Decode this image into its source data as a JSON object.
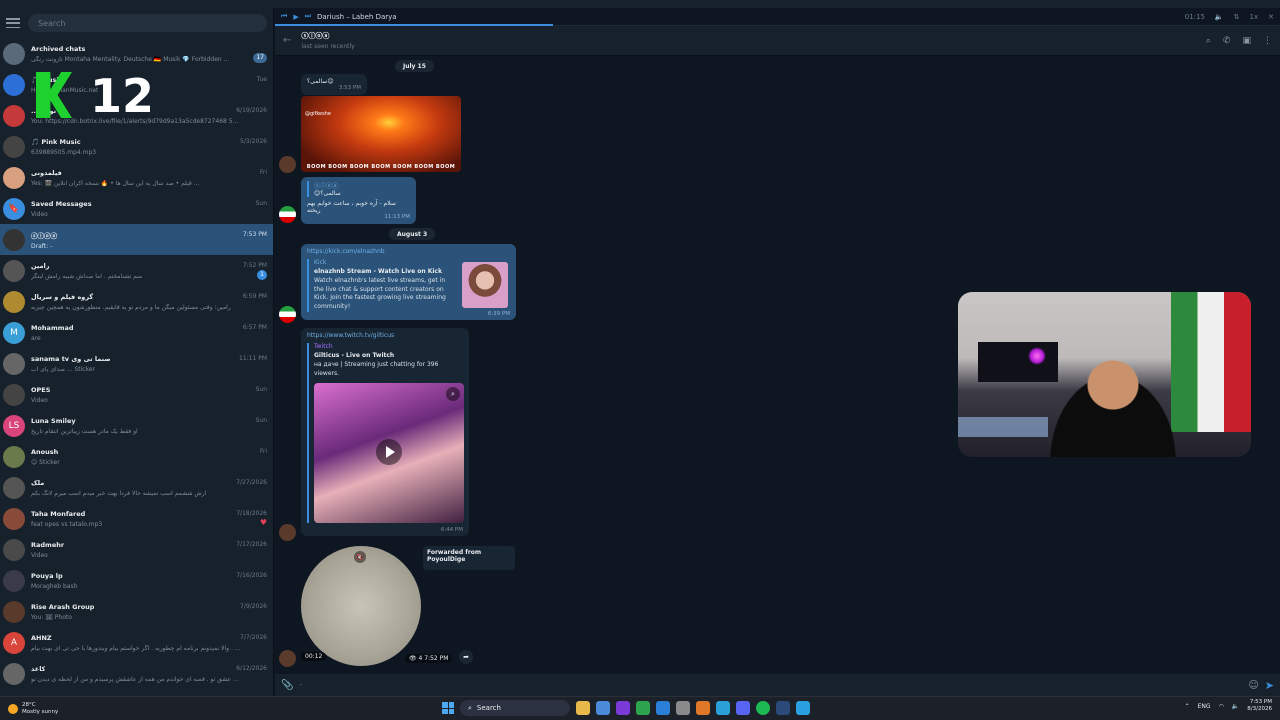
{
  "sidebar": {
    "search_placeholder": "Search",
    "chats": [
      {
        "name": "Archived chats",
        "time": "",
        "msg": "تارونت رنگی Montaha Mentality. Deutsche 🇩🇪 Musik 💎 Forbidden ...",
        "badge": "17",
        "avatar_color": "#5a6a7a",
        "avatar_text": ""
      },
      {
        "name": "🎵 Music",
        "time": "Tue",
        "msg": "Heyran ahanMusic.net",
        "badge": "",
        "avatar_color": "#2c6fd6",
        "avatar_text": ""
      },
      {
        "name": "... نوسا",
        "time": "6/19/2026",
        "msg": "You: https://cdn.botrix.live/file/1/alerts/9d79d9a13a5cde8727468 5aa4...",
        "badge": "",
        "avatar_color": "#c43a3a",
        "avatar_text": ""
      },
      {
        "name": "🎵 Pink Music",
        "time": "5/3/2026",
        "msg": "639889505.mp4.mp3",
        "badge": "",
        "avatar_color": "#444",
        "avatar_text": ""
      },
      {
        "name": "فیلمدونی",
        "time": "Fri",
        "msg": "Yes: 🎬 قیلم • صد سال یه این سال ها • 🔥 نسخه اکران آنلاین ...",
        "badge": "",
        "avatar_color": "#d9a080",
        "avatar_text": ""
      },
      {
        "name": "Saved Messages",
        "time": "Sun",
        "msg": "Video",
        "badge": "",
        "avatar_color": "#3a8ee0",
        "avatar_text": "🔖"
      },
      {
        "name": "ⓢⓘⓞⓐ",
        "time": "7:53 PM",
        "msg": "Draft: -",
        "badge": "",
        "avatar_color": "#333",
        "avatar_text": ""
      },
      {
        "name": "رامین",
        "time": "7:52 PM",
        "msg": "منم تشنامختم . اما صداش شبیه رامش لبتگر",
        "badge": "1",
        "avatar_color": "#555",
        "avatar_text": ""
      },
      {
        "name": "گروه فیلم و سریال",
        "time": "6:59 PM",
        "msg": "رامین: وقتی مسئولین میگن ما و مردم تو یه قایقیم. منظورشون یه همچین چیزیه",
        "badge": "",
        "avatar_color": "#b08a30",
        "avatar_text": ""
      },
      {
        "name": "Mohammad",
        "time": "6:57 PM",
        "msg": "are",
        "badge": "",
        "avatar_color": "#3a9fd6",
        "avatar_text": "M"
      },
      {
        "name": "sanama tv صنما تی وی",
        "time": "11:11 PM",
        "msg": "صدای پای آب ... Sticker",
        "badge": "",
        "avatar_color": "#666",
        "avatar_text": ""
      },
      {
        "name": "OPES",
        "time": "Sun",
        "msg": "Video",
        "badge": "",
        "avatar_color": "#444",
        "avatar_text": ""
      },
      {
        "name": "Luna Smiley",
        "time": "Sun",
        "msg": "او فقط یک مادر هست زیباترین انتقام تاریخ",
        "badge": "",
        "avatar_color": "#d9457a",
        "avatar_text": "LS"
      },
      {
        "name": "Anoush",
        "time": "Fri",
        "msg": "😊 Sticker",
        "badge": "",
        "avatar_color": "#6a7a4a",
        "avatar_text": ""
      },
      {
        "name": "ملک",
        "time": "7/27/2026",
        "msg": "آرش ششمم اسب تمیشه حالا فردا بهت خبر میدم اسب میرم لانگ بکم",
        "badge": "",
        "avatar_color": "#555",
        "avatar_text": ""
      },
      {
        "name": "Taha Monfared",
        "time": "7/18/2026",
        "msg": "feat opes vs tatalo.mp3",
        "badge": "♥",
        "avatar_color": "#8a4a3a",
        "avatar_text": ""
      },
      {
        "name": "Radmehr",
        "time": "7/17/2026",
        "msg": "Video",
        "badge": "",
        "avatar_color": "#4a4a4a",
        "avatar_text": ""
      },
      {
        "name": "Pouya lp",
        "time": "7/16/2026",
        "msg": "Moragheb bash",
        "badge": "",
        "avatar_color": "#3a3a4a",
        "avatar_text": ""
      },
      {
        "name": "Rise Arash Group",
        "time": "7/9/2026",
        "msg": "You: 🖼 Photo",
        "badge": "",
        "avatar_color": "#5a3a2a",
        "avatar_text": ""
      },
      {
        "name": "AHNZ",
        "time": "7/7/2026",
        "msg": "سلام آرش جون . والا نمیدونم برنامه ام چطوریه . اگر خواستم بیام ویندوزها با جی تی ای بهت بیام",
        "badge": "",
        "avatar_color": "#d9453a",
        "avatar_text": "A"
      },
      {
        "name": "کاغد",
        "time": "6/12/2026",
        "msg": "هر جا که از عشق تو . قصه ای خواندم من همه از عاشقش پرسیدم و من از لحظه ی دیدن تو",
        "badge": "",
        "avatar_color": "#666",
        "avatar_text": ""
      }
    ]
  },
  "overlay": {
    "logo_number": "12"
  },
  "player": {
    "track": "Dariush – Labeh Darya",
    "time": "01:15"
  },
  "header": {
    "title": "ⓢⓘⓞⓐ",
    "subtitle": "last seen recently"
  },
  "messages": {
    "date1": "July 15",
    "msg1_text": "سالمی؟😊",
    "msg1_time": "3:53 PM",
    "gif_watermark": "@gifkeshe",
    "gif_caption": "BOOM BOOM BOOM BOOM BOOM BOOM BOOM",
    "reply_name": "ⓢⓘⓞⓐ",
    "reply_quote": "😊سالمی؟",
    "msg2_text": "سلام - آره خوبم ، ساعت خوابم بهم ریخته",
    "msg2_time": "11:13 PM",
    "date2": "August 3",
    "kick_url": "https://kick.com/elnazhnb",
    "kick_site": "Kick",
    "kick_title": "elnazhnb Stream - Watch Live on Kick",
    "kick_desc": "Watch elnazhnb's latest live streams, get in the live chat & support content creators on Kick. Join the fastest growing live streaming community!",
    "kick_time": "6:39 PM",
    "twitch_url": "https://www.twitch.tv/gilticus",
    "twitch_site": "Twitch",
    "twitch_title": "Gilticus - Live on Twitch",
    "twitch_desc": "на даче | Streaming just chatting for 396 viewers.",
    "twitch_time": "6:44 PM",
    "fwd_label": "Forwarded from",
    "fwd_name": "PoyoulDige",
    "video_duration": "00:12",
    "video_views": "👁 4",
    "video_time": "7:52 PM"
  },
  "composer": {
    "placeholder": "-"
  },
  "taskbar": {
    "temp": "28°C",
    "weather": "Mostly sunny",
    "search": "Search",
    "lang": "ENG",
    "time": "7:53 PM",
    "date": "8/3/2026"
  }
}
